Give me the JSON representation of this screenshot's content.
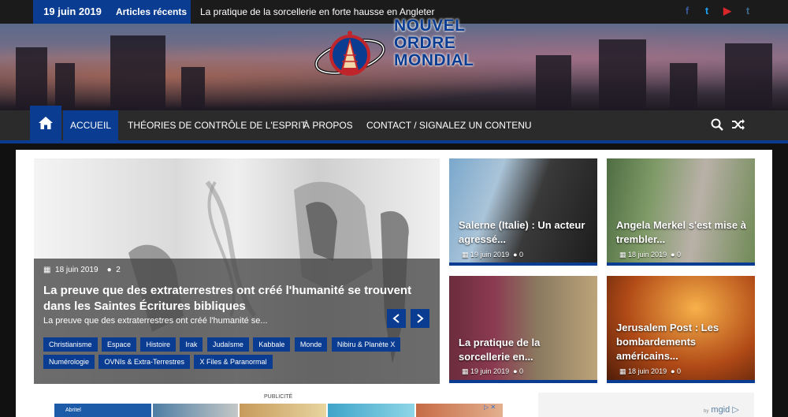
{
  "topbar": {
    "date": "19 juin 2019",
    "recent_label": "Articles récents",
    "ticker": "La pratique de la sorcellerie en forte hausse en Angleter",
    "social": [
      {
        "icon": "facebook-icon",
        "glyph": "f",
        "color": "#3b5998"
      },
      {
        "icon": "twitter-icon",
        "glyph": "t",
        "color": "#1da1f2"
      },
      {
        "icon": "youtube-icon",
        "glyph": "▶",
        "color": "#d8262a"
      },
      {
        "icon": "tumblr-icon",
        "glyph": "t",
        "color": "#3e6a8c"
      }
    ]
  },
  "header": {
    "logo_line1": "NOUVEL",
    "logo_line2": "ORDRE",
    "logo_line3": "MONDIAL",
    "brand_color": "#0a3d91"
  },
  "nav": {
    "home_icon": "home-icon",
    "items": [
      "ACCUEIL",
      "THÉORIES DE CONTRÔLE DE L'ESPRIT",
      "À PROPOS",
      "CONTACT / SIGNALEZ UN CONTENU"
    ],
    "search_icon": "search-icon",
    "shuffle_icon": "shuffle-icon"
  },
  "slider": {
    "date": "18 juin 2019",
    "comments": "2",
    "title": "La preuve que des extraterrestres ont créé l'humanité se trouvent dans les Saintes Écritures bibliques",
    "excerpt": "La preuve que des extraterrestres ont créé l'humanité se...",
    "tags": [
      "Christianisme",
      "Espace",
      "Histoire",
      "Irak",
      "Judaïsme",
      "Kabbale",
      "Monde",
      "Nibiru & Planète X",
      "Numérologie",
      "OVNIs & Extra-Terrestres",
      "X Files & Paranormal"
    ]
  },
  "cards": [
    {
      "title": "Salerne (Italie) : Un acteur agressé...",
      "date": "19 juin 2019",
      "comments": "0"
    },
    {
      "title": "Angela Merkel s'est mise à trembler...",
      "date": "18 juin 2019",
      "comments": "0"
    },
    {
      "title": "La pratique de la sorcellerie en...",
      "date": "19 juin 2019",
      "comments": "0"
    },
    {
      "title": "Jerusalem Post : Les bombardements américains...",
      "date": "18 juin 2019",
      "comments": "0"
    }
  ],
  "ads": {
    "label": "PUBLICITÉ",
    "first_ad_text": "Abritel",
    "mgid_prefix": "by",
    "mgid": "mgid"
  }
}
